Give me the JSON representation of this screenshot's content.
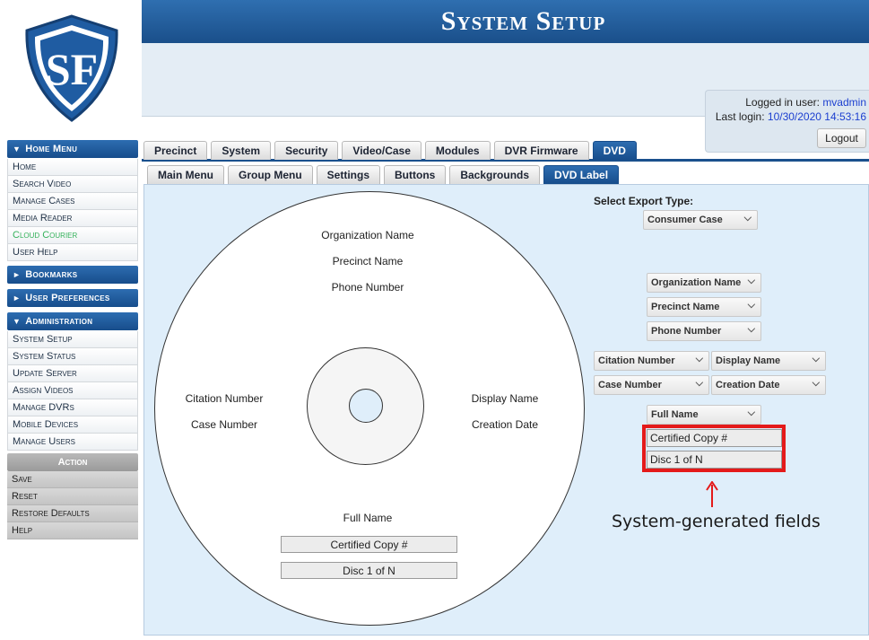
{
  "app": {
    "title": "System Setup",
    "logo_text": "SF"
  },
  "login": {
    "user_label": "Logged in user:",
    "user_value": "mvadmin",
    "last_label": "Last login:",
    "last_value": "10/30/2020 14:53:16",
    "logout_label": "Logout"
  },
  "sidebar": {
    "home_menu": "Home Menu",
    "home_items": [
      "Home",
      "Search Video",
      "Manage Cases",
      "Media Reader",
      "Cloud Courier",
      "User Help"
    ],
    "bookmarks": "Bookmarks",
    "user_prefs": "User Preferences",
    "administration": "Administration",
    "admin_items": [
      "System Setup",
      "System Status",
      "Update Server",
      "Assign Videos",
      "Manage DVRs",
      "Mobile Devices",
      "Manage Users"
    ],
    "action_head": "Action",
    "action_items": [
      "Save",
      "Reset",
      "Restore Defaults",
      "Help"
    ]
  },
  "tabs_primary": [
    "Precinct",
    "System",
    "Security",
    "Video/Case",
    "Modules",
    "DVR Firmware",
    "DVD"
  ],
  "tabs_secondary": [
    "Main Menu",
    "Group Menu",
    "Settings",
    "Buttons",
    "Backgrounds",
    "DVD Label"
  ],
  "disc": {
    "org": "Organization Name",
    "precinct": "Precinct Name",
    "phone": "Phone Number",
    "citation": "Citation Number",
    "case": "Case Number",
    "display": "Display Name",
    "creation": "Creation Date",
    "full_name": "Full Name",
    "certified": "Certified Copy #",
    "disc_n": "Disc 1 of N"
  },
  "controls": {
    "export_label": "Select Export Type:",
    "export_value": "Consumer Case",
    "sel_org": "Organization Name",
    "sel_precinct": "Precinct Name",
    "sel_phone": "Phone Number",
    "sel_citation": "Citation Number",
    "sel_display": "Display Name",
    "sel_case": "Case Number",
    "sel_creation": "Creation Date",
    "sel_fullname": "Full Name",
    "sys_certified": "Certified Copy #",
    "sys_disc": "Disc 1 of N"
  },
  "annotation": "System-generated fields",
  "colors": {
    "brand_blue": "#1a508d",
    "highlight_red": "#e41a1a",
    "panel_bg": "#dfeefa",
    "green_item": "#36b25c"
  }
}
